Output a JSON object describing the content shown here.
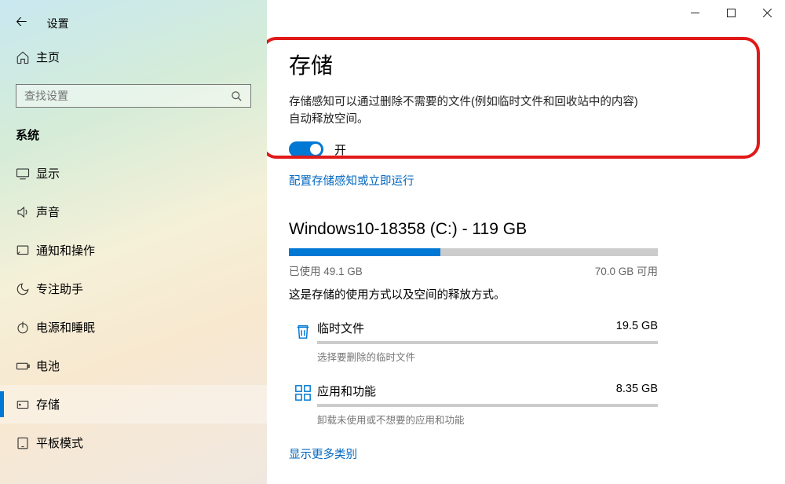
{
  "window": {
    "title": "设置"
  },
  "sidebar": {
    "home": "主页",
    "search_placeholder": "查找设置",
    "section": "系统",
    "items": [
      {
        "label": "显示",
        "icon": "display"
      },
      {
        "label": "声音",
        "icon": "sound"
      },
      {
        "label": "通知和操作",
        "icon": "notification"
      },
      {
        "label": "专注助手",
        "icon": "focus"
      },
      {
        "label": "电源和睡眠",
        "icon": "power"
      },
      {
        "label": "电池",
        "icon": "battery"
      },
      {
        "label": "存储",
        "icon": "storage",
        "active": true
      },
      {
        "label": "平板模式",
        "icon": "tablet"
      }
    ]
  },
  "main": {
    "title": "存储",
    "sense_desc": "存储感知可以通过删除不需要的文件(例如临时文件和回收站中的内容)自动释放空间。",
    "toggle_state": "开",
    "config_link": "配置存储感知或立即运行",
    "drive": {
      "title": "Windows10-18358 (C:) - 119 GB",
      "used_label": "已使用",
      "used_value": "49.1 GB",
      "free_value": "70.0 GB",
      "free_label": "可用",
      "usage_desc": "这是存储的使用方式以及空间的释放方式。"
    },
    "categories": [
      {
        "name": "临时文件",
        "size": "19.5 GB",
        "sub": "选择要删除的临时文件",
        "icon": "trash"
      },
      {
        "name": "应用和功能",
        "size": "8.35 GB",
        "sub": "卸载未使用或不想要的应用和功能",
        "icon": "apps"
      }
    ],
    "more_link": "显示更多类别"
  }
}
